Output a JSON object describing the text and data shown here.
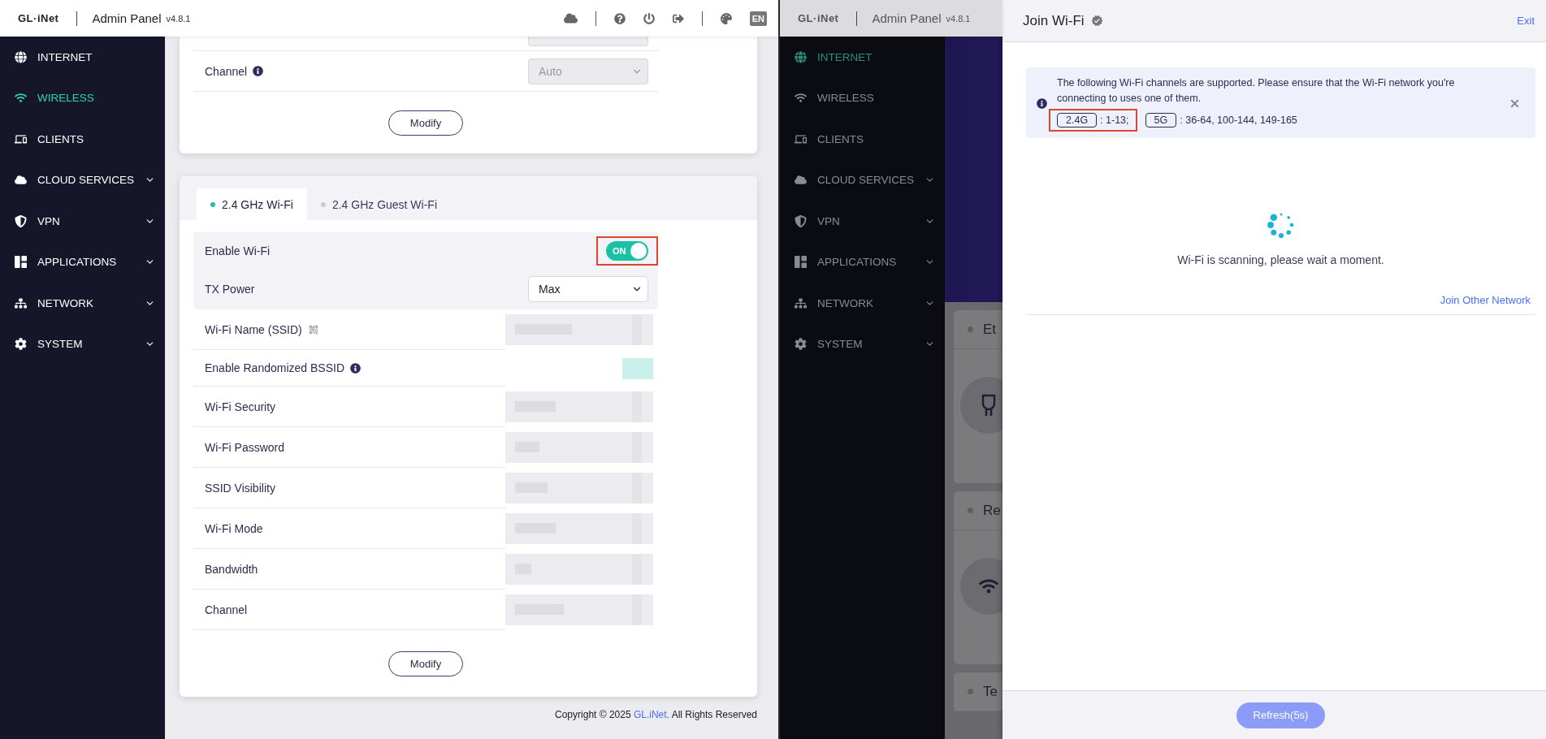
{
  "left_screen": {
    "header": {
      "logo": "GL·iNet",
      "title": "Admin Panel",
      "version": "v4.8.1",
      "language": "EN"
    },
    "sidebar": {
      "items": [
        {
          "label": "INTERNET",
          "selected": false,
          "expandable": false
        },
        {
          "label": "WIRELESS",
          "selected": true,
          "expandable": false
        },
        {
          "label": "CLIENTS",
          "selected": false,
          "expandable": false
        },
        {
          "label": "CLOUD SERVICES",
          "selected": false,
          "expandable": true
        },
        {
          "label": "VPN",
          "selected": false,
          "expandable": true
        },
        {
          "label": "APPLICATIONS",
          "selected": false,
          "expandable": true
        },
        {
          "label": "NETWORK",
          "selected": false,
          "expandable": true
        },
        {
          "label": "SYSTEM",
          "selected": false,
          "expandable": true
        }
      ]
    },
    "top_card": {
      "rows": [
        {
          "label": "Channel",
          "info_icon": true,
          "value": "Auto",
          "disabled": true
        }
      ],
      "button": "Modify"
    },
    "wifi_card": {
      "tabs": [
        {
          "label": "2.4 GHz Wi-Fi",
          "selected": true
        },
        {
          "label": "2.4 GHz Guest Wi-Fi",
          "selected": false
        }
      ],
      "primary_rows": [
        {
          "kind": "toggle",
          "label": "Enable Wi-Fi",
          "on": true,
          "toggle_text": "ON",
          "highlighted": true
        },
        {
          "kind": "select",
          "label": "TX Power",
          "value": "Max"
        }
      ],
      "rows": [
        {
          "kind": "redacted",
          "label": "Wi-Fi Name (SSID)",
          "qr_icon": true
        },
        {
          "kind": "redacted_toggle",
          "label": "Enable Randomized BSSID",
          "info_icon": true,
          "on": true
        },
        {
          "kind": "redacted",
          "label": "Wi-Fi Security"
        },
        {
          "kind": "redacted",
          "label": "Wi-Fi Password"
        },
        {
          "kind": "redacted",
          "label": "SSID Visibility"
        },
        {
          "kind": "redacted",
          "label": "Wi-Fi Mode"
        },
        {
          "kind": "redacted",
          "label": "Bandwidth"
        },
        {
          "kind": "redacted",
          "label": "Channel"
        }
      ],
      "button": "Modify"
    },
    "footer": {
      "prefix": "Copyright © 2025 ",
      "link": "GL.iNet.",
      "suffix": " All Rights Reserved"
    }
  },
  "right_screen": {
    "header": {
      "logo": "GL·iNet",
      "title": "Admin Panel",
      "version": "v4.8.1"
    },
    "sidebar": {
      "items": [
        {
          "label": "INTERNET",
          "selected": true,
          "expandable": false
        },
        {
          "label": "WIRELESS",
          "selected": false,
          "expandable": false
        },
        {
          "label": "CLIENTS",
          "selected": false,
          "expandable": false
        },
        {
          "label": "CLOUD SERVICES",
          "selected": false,
          "expandable": true
        },
        {
          "label": "VPN",
          "selected": false,
          "expandable": true
        },
        {
          "label": "APPLICATIONS",
          "selected": false,
          "expandable": true
        },
        {
          "label": "NETWORK",
          "selected": false,
          "expandable": true
        },
        {
          "label": "SYSTEM",
          "selected": false,
          "expandable": true
        }
      ]
    },
    "cards": [
      {
        "title": "Et"
      },
      {
        "title": "Re"
      },
      {
        "title": "Te"
      }
    ],
    "drawer": {
      "title": "Join Wi-Fi",
      "exit": "Exit",
      "notice": {
        "text": "The following Wi-Fi channels are supported. Please ensure that the Wi-Fi network you're connecting to uses one of them.",
        "bands": [
          {
            "label": "2.4G",
            "channels": ": 1-13;",
            "highlighted": true
          },
          {
            "label": "5G",
            "channels": ": 36-64, 100-144, 149-165"
          }
        ]
      },
      "status": "Wi-Fi is scanning, please wait a moment.",
      "join_other": "Join Other Network",
      "refresh": {
        "label": "Refresh(5s)",
        "disabled": true
      }
    }
  }
}
